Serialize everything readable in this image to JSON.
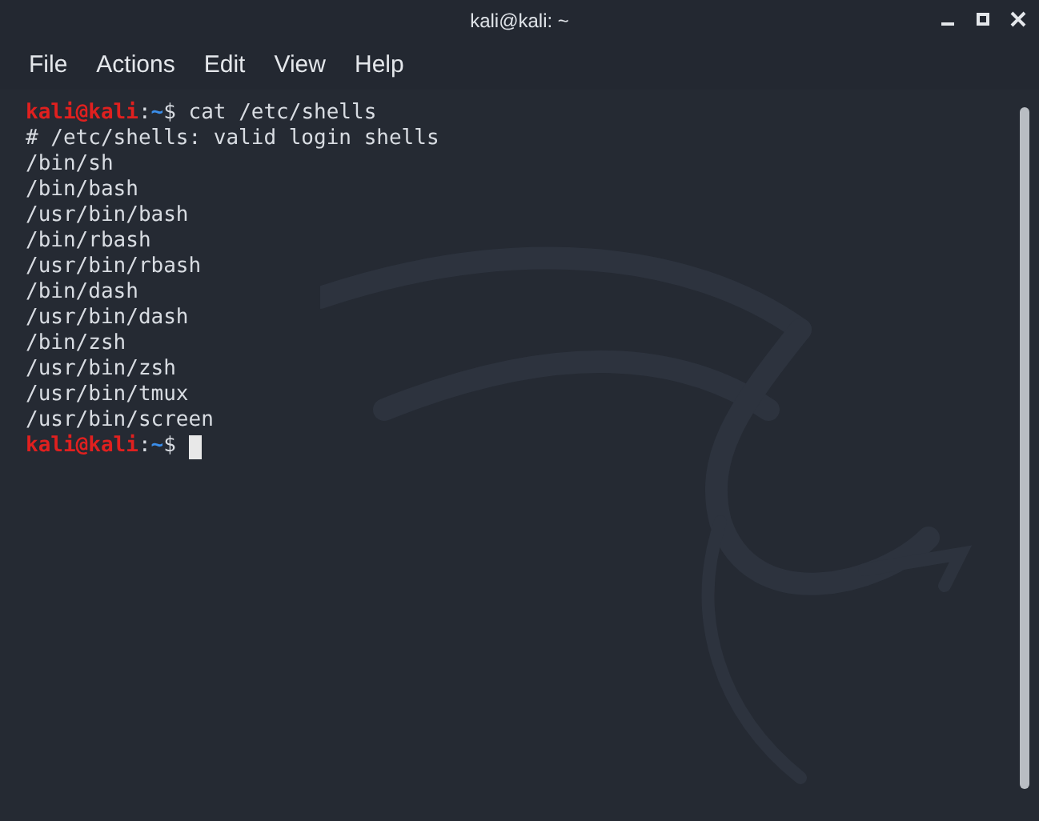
{
  "window": {
    "title": "kali@kali: ~"
  },
  "menu": [
    "File",
    "Actions",
    "Edit",
    "View",
    "Help"
  ],
  "terminal": {
    "lines": [
      {
        "kind": "prompt",
        "user_host": "kali@kali",
        "separator": ":",
        "path": "~",
        "symbol": "$",
        "command": "cat /etc/shells"
      },
      {
        "kind": "output",
        "text": "# /etc/shells: valid login shells"
      },
      {
        "kind": "output",
        "text": "/bin/sh"
      },
      {
        "kind": "output",
        "text": "/bin/bash"
      },
      {
        "kind": "output",
        "text": "/usr/bin/bash"
      },
      {
        "kind": "output",
        "text": "/bin/rbash"
      },
      {
        "kind": "output",
        "text": "/usr/bin/rbash"
      },
      {
        "kind": "output",
        "text": "/bin/dash"
      },
      {
        "kind": "output",
        "text": "/usr/bin/dash"
      },
      {
        "kind": "output",
        "text": "/bin/zsh"
      },
      {
        "kind": "output",
        "text": "/usr/bin/zsh"
      },
      {
        "kind": "output",
        "text": "/usr/bin/tmux"
      },
      {
        "kind": "output",
        "text": "/usr/bin/screen"
      },
      {
        "kind": "prompt",
        "user_host": "kali@kali",
        "separator": ":",
        "path": "~",
        "symbol": "$",
        "cursor": true
      }
    ]
  }
}
